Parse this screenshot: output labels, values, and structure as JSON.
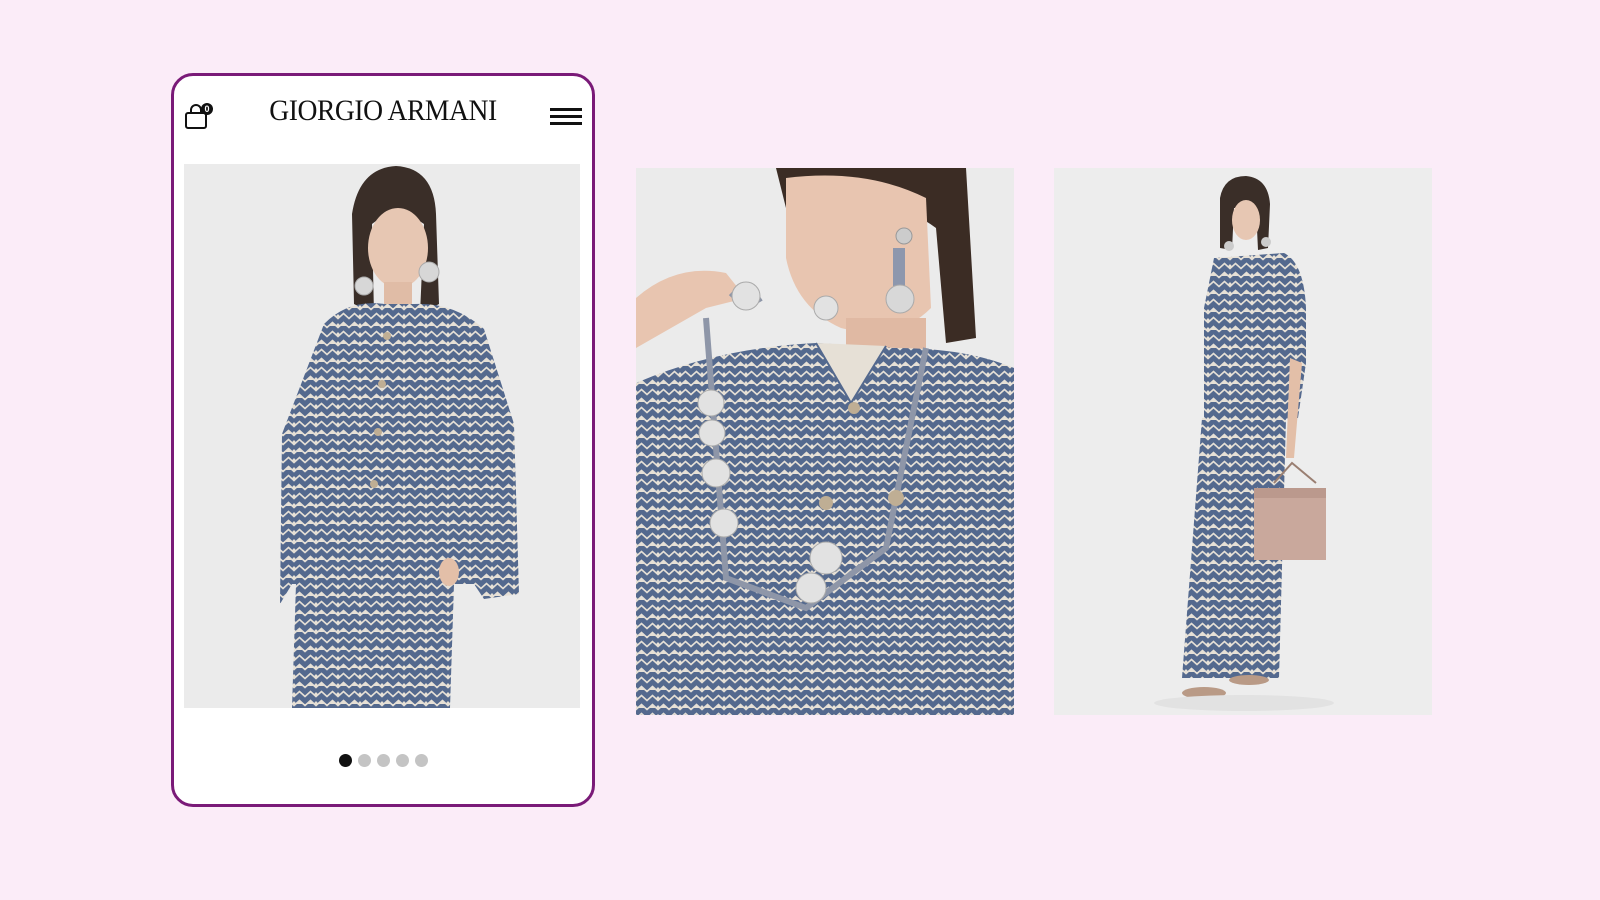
{
  "header": {
    "brand": "GIORGIO ARMANI",
    "cart_count": "0",
    "cart_icon": "shopping-bag-icon",
    "menu_icon": "hamburger-menu-icon"
  },
  "gallery": {
    "slide_count": 5,
    "active_index": 0,
    "images": [
      {
        "alt": "Model in zigzag print shirt jacket, front view"
      },
      {
        "alt": "Close-up of model with beaded necklace and chevron shirt"
      },
      {
        "alt": "Full-length model in chevron print set holding a pink bag"
      }
    ]
  },
  "colors": {
    "background": "#fbecf8",
    "frame_border": "#7a1a78",
    "dot_active": "#111111",
    "dot_inactive": "#c4c4c4"
  }
}
